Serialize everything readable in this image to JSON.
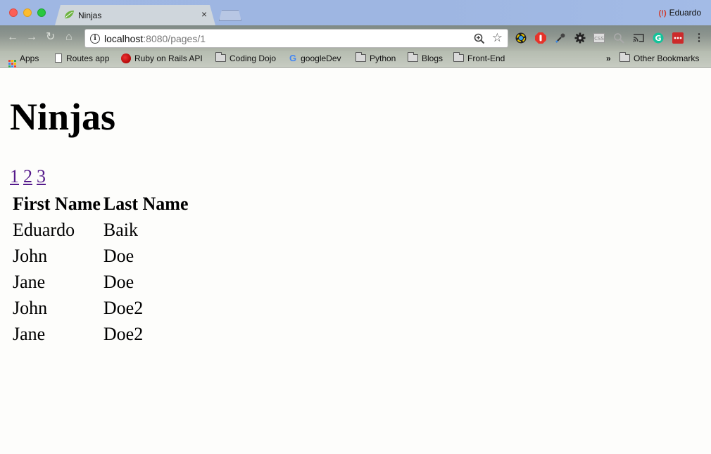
{
  "browser": {
    "tab_title": "Ninjas",
    "tab_close": "×",
    "profile_name": "Eduardo",
    "url_host": "localhost",
    "url_path": ":8080/pages/1",
    "nav": {
      "back": "←",
      "forward": "→",
      "reload": "↻",
      "home": "⌂"
    },
    "bookmarks": [
      {
        "label": "Apps",
        "icon": "apps-grid-icon"
      },
      {
        "label": "Routes app",
        "icon": "document-icon"
      },
      {
        "label": "Ruby on Rails API",
        "icon": "rails-icon"
      },
      {
        "label": "Coding Dojo",
        "icon": "folder-icon"
      },
      {
        "label": "googleDev",
        "icon": "google-icon"
      },
      {
        "label": "Python",
        "icon": "folder-icon"
      },
      {
        "label": "Blogs",
        "icon": "folder-icon"
      },
      {
        "label": "Front-End",
        "icon": "folder-icon"
      },
      {
        "label": "Other Bookmarks",
        "icon": "folder-icon"
      }
    ],
    "overflow_chevron": "»",
    "colors": {
      "tabbar": "#9fb7e3",
      "link_visited": "#551a8b"
    }
  },
  "page": {
    "heading": "Ninjas",
    "pages": [
      "1",
      "2",
      "3"
    ],
    "table": {
      "headers": [
        "First Name",
        "Last Name"
      ],
      "rows": [
        [
          "Eduardo",
          "Baik"
        ],
        [
          "John",
          "Doe"
        ],
        [
          "Jane",
          "Doe"
        ],
        [
          "John",
          "Doe2"
        ],
        [
          "Jane",
          "Doe2"
        ]
      ]
    }
  }
}
